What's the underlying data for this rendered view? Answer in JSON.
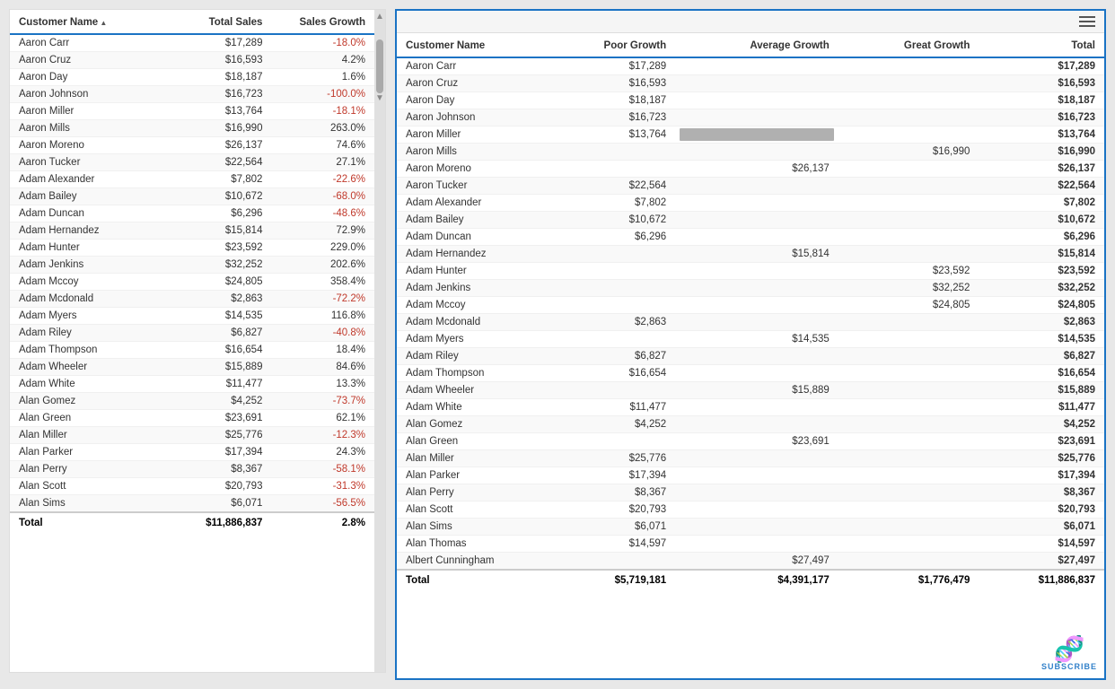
{
  "left_table": {
    "headers": [
      "Customer Name",
      "Total Sales",
      "Sales Growth"
    ],
    "rows": [
      [
        "Aaron Carr",
        "$17,289",
        "-18.0%"
      ],
      [
        "Aaron Cruz",
        "$16,593",
        "4.2%"
      ],
      [
        "Aaron Day",
        "$18,187",
        "1.6%"
      ],
      [
        "Aaron Johnson",
        "$16,723",
        "-100.0%"
      ],
      [
        "Aaron Miller",
        "$13,764",
        "-18.1%"
      ],
      [
        "Aaron Mills",
        "$16,990",
        "263.0%"
      ],
      [
        "Aaron Moreno",
        "$26,137",
        "74.6%"
      ],
      [
        "Aaron Tucker",
        "$22,564",
        "27.1%"
      ],
      [
        "Adam Alexander",
        "$7,802",
        "-22.6%"
      ],
      [
        "Adam Bailey",
        "$10,672",
        "-68.0%"
      ],
      [
        "Adam Duncan",
        "$6,296",
        "-48.6%"
      ],
      [
        "Adam Hernandez",
        "$15,814",
        "72.9%"
      ],
      [
        "Adam Hunter",
        "$23,592",
        "229.0%"
      ],
      [
        "Adam Jenkins",
        "$32,252",
        "202.6%"
      ],
      [
        "Adam Mccoy",
        "$24,805",
        "358.4%"
      ],
      [
        "Adam Mcdonald",
        "$2,863",
        "-72.2%"
      ],
      [
        "Adam Myers",
        "$14,535",
        "116.8%"
      ],
      [
        "Adam Riley",
        "$6,827",
        "-40.8%"
      ],
      [
        "Adam Thompson",
        "$16,654",
        "18.4%"
      ],
      [
        "Adam Wheeler",
        "$15,889",
        "84.6%"
      ],
      [
        "Adam White",
        "$11,477",
        "13.3%"
      ],
      [
        "Alan Gomez",
        "$4,252",
        "-73.7%"
      ],
      [
        "Alan Green",
        "$23,691",
        "62.1%"
      ],
      [
        "Alan Miller",
        "$25,776",
        "-12.3%"
      ],
      [
        "Alan Parker",
        "$17,394",
        "24.3%"
      ],
      [
        "Alan Perry",
        "$8,367",
        "-58.1%"
      ],
      [
        "Alan Scott",
        "$20,793",
        "-31.3%"
      ],
      [
        "Alan Sims",
        "$6,071",
        "-56.5%"
      ]
    ],
    "footer": [
      "Total",
      "$11,886,837",
      "2.8%"
    ]
  },
  "right_table": {
    "headers": [
      "Customer Name",
      "Poor Growth",
      "Average Growth",
      "Great Growth",
      "Total"
    ],
    "rows": [
      [
        "Aaron Carr",
        "$17,289",
        "",
        "",
        "$17,289"
      ],
      [
        "Aaron Cruz",
        "$16,593",
        "",
        "",
        "$16,593"
      ],
      [
        "Aaron Day",
        "$18,187",
        "",
        "",
        "$18,187"
      ],
      [
        "Aaron Johnson",
        "$16,723",
        "",
        "",
        "$16,723"
      ],
      [
        "Aaron Miller",
        "$13,764",
        "BAR",
        "",
        "$13,764"
      ],
      [
        "Aaron Mills",
        "",
        "",
        "$16,990",
        "$16,990"
      ],
      [
        "Aaron Moreno",
        "",
        "$26,137",
        "",
        "$26,137"
      ],
      [
        "Aaron Tucker",
        "$22,564",
        "",
        "",
        "$22,564"
      ],
      [
        "Adam Alexander",
        "$7,802",
        "",
        "",
        "$7,802"
      ],
      [
        "Adam Bailey",
        "$10,672",
        "",
        "",
        "$10,672"
      ],
      [
        "Adam Duncan",
        "$6,296",
        "",
        "",
        "$6,296"
      ],
      [
        "Adam Hernandez",
        "",
        "$15,814",
        "",
        "$15,814"
      ],
      [
        "Adam Hunter",
        "",
        "",
        "$23,592",
        "$23,592"
      ],
      [
        "Adam Jenkins",
        "",
        "",
        "$32,252",
        "$32,252"
      ],
      [
        "Adam Mccoy",
        "",
        "",
        "$24,805",
        "$24,805"
      ],
      [
        "Adam Mcdonald",
        "$2,863",
        "",
        "",
        "$2,863"
      ],
      [
        "Adam Myers",
        "",
        "$14,535",
        "",
        "$14,535"
      ],
      [
        "Adam Riley",
        "$6,827",
        "",
        "",
        "$6,827"
      ],
      [
        "Adam Thompson",
        "$16,654",
        "",
        "",
        "$16,654"
      ],
      [
        "Adam Wheeler",
        "",
        "$15,889",
        "",
        "$15,889"
      ],
      [
        "Adam White",
        "$11,477",
        "",
        "",
        "$11,477"
      ],
      [
        "Alan Gomez",
        "$4,252",
        "",
        "",
        "$4,252"
      ],
      [
        "Alan Green",
        "",
        "$23,691",
        "",
        "$23,691"
      ],
      [
        "Alan Miller",
        "$25,776",
        "",
        "",
        "$25,776"
      ],
      [
        "Alan Parker",
        "$17,394",
        "",
        "",
        "$17,394"
      ],
      [
        "Alan Perry",
        "$8,367",
        "",
        "",
        "$8,367"
      ],
      [
        "Alan Scott",
        "$20,793",
        "",
        "",
        "$20,793"
      ],
      [
        "Alan Sims",
        "$6,071",
        "",
        "",
        "$6,071"
      ],
      [
        "Alan Thomas",
        "$14,597",
        "",
        "",
        "$14,597"
      ],
      [
        "Albert Cunningham",
        "",
        "$27,497",
        "",
        "$27,497"
      ]
    ],
    "footer": [
      "Total",
      "$5,719,181",
      "$4,391,177",
      "$1,776,479",
      "$11,886,837"
    ]
  },
  "watermark": {
    "icon": "🧬",
    "text": "SUBSCRIBE"
  }
}
